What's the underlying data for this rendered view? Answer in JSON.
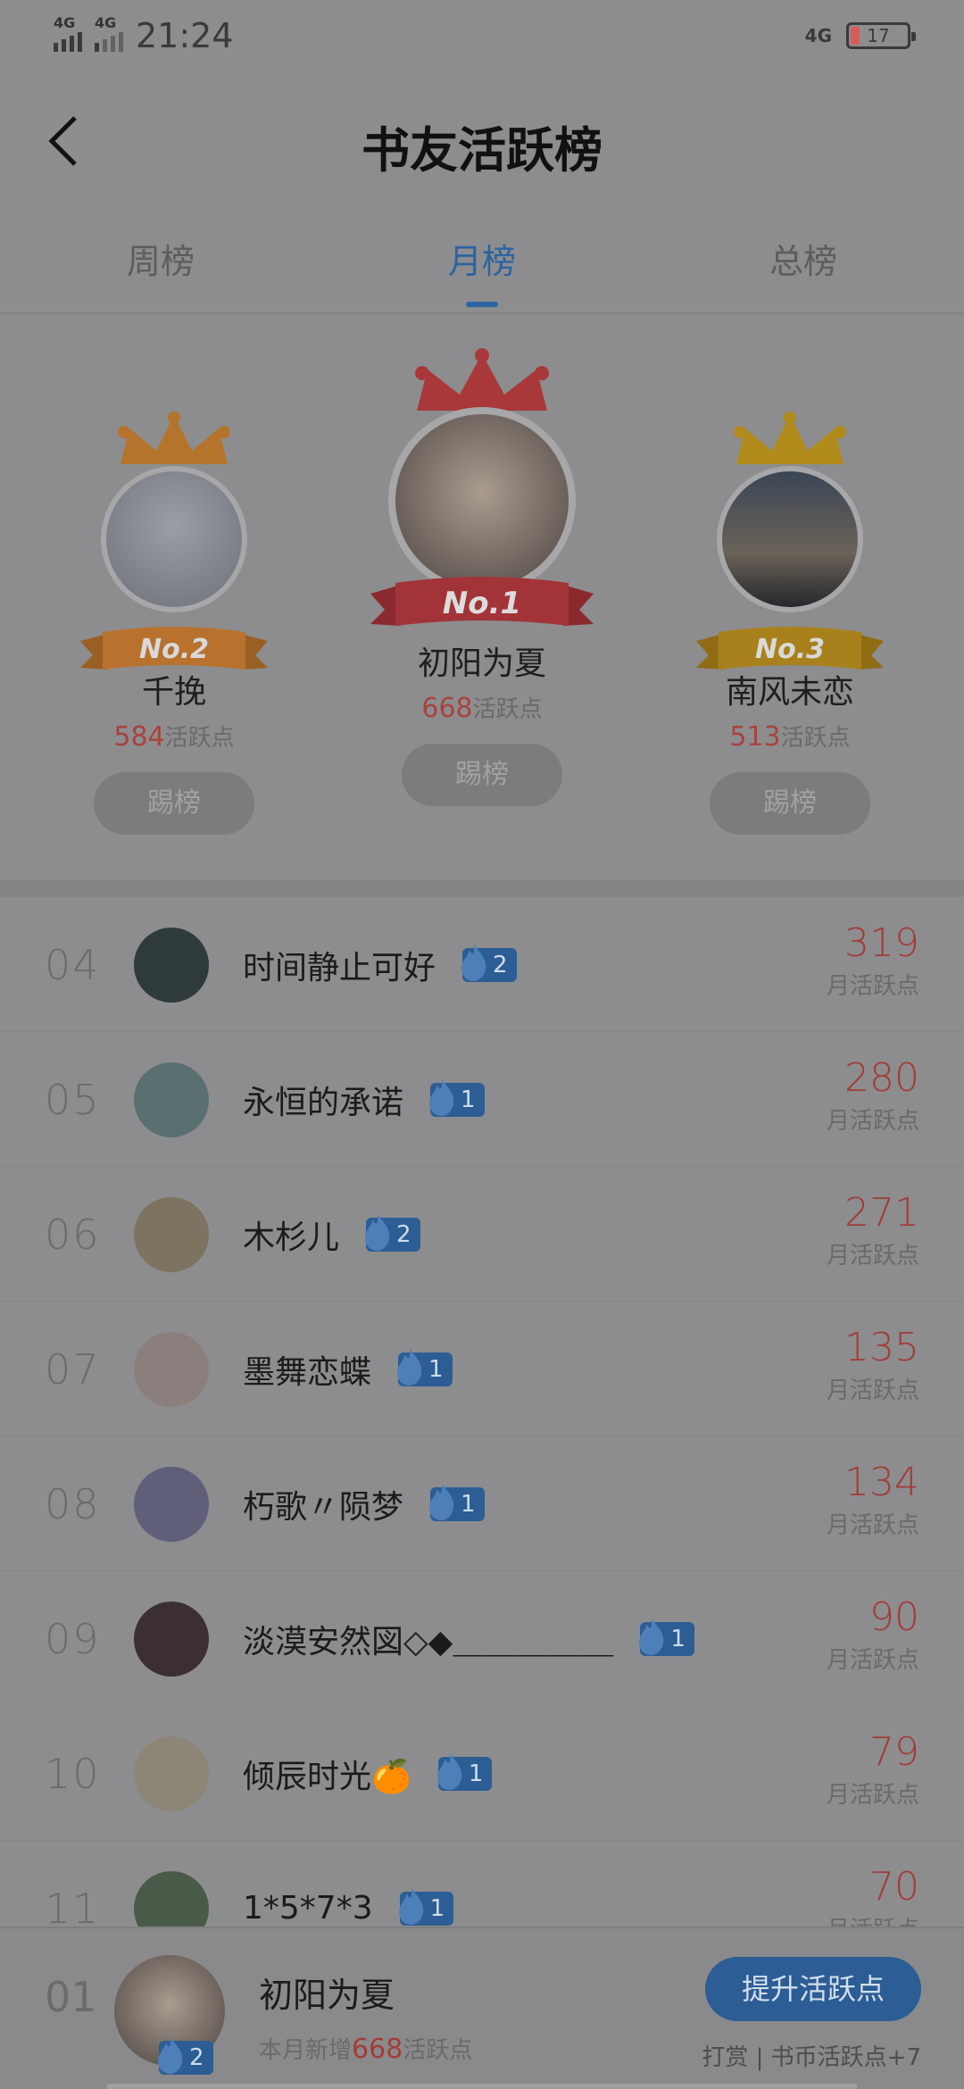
{
  "status_bar": {
    "time": "21:24",
    "signal_left": "4G",
    "signal_right": "4G",
    "network": "4G",
    "battery": "17"
  },
  "header": {
    "title": "书友活跃榜"
  },
  "tabs": [
    {
      "label": "周榜",
      "active": false
    },
    {
      "label": "月榜",
      "active": true
    },
    {
      "label": "总榜",
      "active": false
    }
  ],
  "podium": [
    {
      "rank_label": "No.2",
      "name": "千挽",
      "points": "584",
      "points_unit": "活跃点",
      "button": "踢榜",
      "crown_color": "#b5742c",
      "ribbon_color": "#b8722e"
    },
    {
      "rank_label": "No.1",
      "name": "初阳为夏",
      "points": "668",
      "points_unit": "活跃点",
      "button": "踢榜",
      "crown_color": "#a8383a",
      "ribbon_color": "#a23338"
    },
    {
      "rank_label": "No.3",
      "name": "南风未恋",
      "points": "513",
      "points_unit": "活跃点",
      "button": "踢榜",
      "crown_color": "#b08a1a",
      "ribbon_color": "#a9811c"
    }
  ],
  "list": [
    {
      "rank": "04",
      "name": "时间静止可好",
      "level": "2",
      "score": "319",
      "unit": "月活跃点",
      "avatar_color": "#2f3a3a"
    },
    {
      "rank": "05",
      "name": "永恒的承诺",
      "level": "1",
      "score": "280",
      "unit": "月活跃点",
      "avatar_color": "#5a6f70"
    },
    {
      "rank": "06",
      "name": "木杉儿",
      "level": "2",
      "score": "271",
      "unit": "月活跃点",
      "avatar_color": "#7d7360"
    },
    {
      "rank": "07",
      "name": "墨舞恋蝶",
      "level": "1",
      "score": "135",
      "unit": "月活跃点",
      "avatar_color": "#8a7f7d"
    },
    {
      "rank": "08",
      "name": "朽歌〃陨梦",
      "level": "1",
      "score": "134",
      "unit": "月活跃点",
      "avatar_color": "#5f5f7a"
    },
    {
      "rank": "09",
      "name": "淡漠安然図◇◆＿＿＿＿＿",
      "level": "1",
      "score": "90",
      "unit": "月活跃点",
      "avatar_color": "#3b2f31"
    },
    {
      "rank": "10",
      "name": "倾辰时光🍊",
      "level": "1",
      "score": "79",
      "unit": "月活跃点",
      "avatar_color": "#8d8677"
    },
    {
      "rank": "11",
      "name": "1*5*7*3",
      "level": "1",
      "score": "70",
      "unit": "月活跃点",
      "avatar_color": "#4a5a48"
    }
  ],
  "me": {
    "rank": "01",
    "name": "初阳为夏",
    "level": "2",
    "sub_prefix": "本月新增",
    "sub_points": "668",
    "sub_suffix": "活跃点",
    "raise_button": "提升活跃点",
    "tip": "打赏 | 书币活跃点+7"
  }
}
